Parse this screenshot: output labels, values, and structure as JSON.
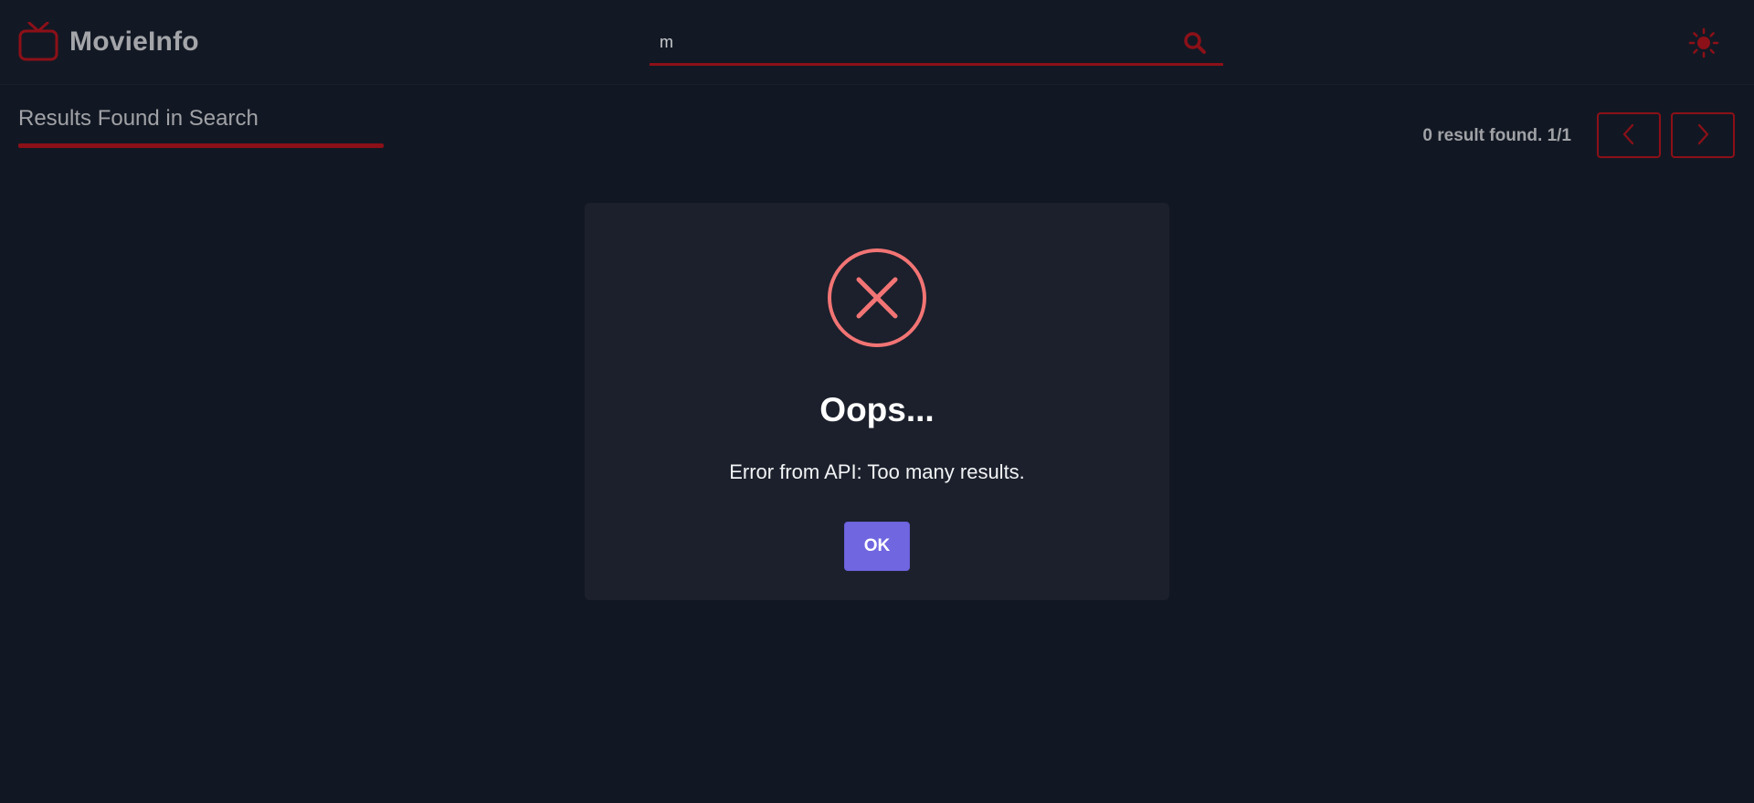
{
  "header": {
    "app_title": "MovieInfo",
    "logo_icon": "tv-icon",
    "theme_icon": "sun-icon"
  },
  "search": {
    "value": "m",
    "icon": "search-icon"
  },
  "results": {
    "title": "Results Found in Search",
    "count_text": "0 result found. 1/1",
    "prev_icon": "chevron-left-icon",
    "next_icon": "chevron-right-icon"
  },
  "modal": {
    "icon": "error-x-icon",
    "title": "Oops...",
    "message": "Error from API: Too many results.",
    "ok_label": "OK"
  },
  "colors": {
    "background": "#121823",
    "accent": "#8c1018",
    "modal_bg": "#1b202c",
    "error": "#f27474",
    "confirm_button": "#7066e0"
  }
}
